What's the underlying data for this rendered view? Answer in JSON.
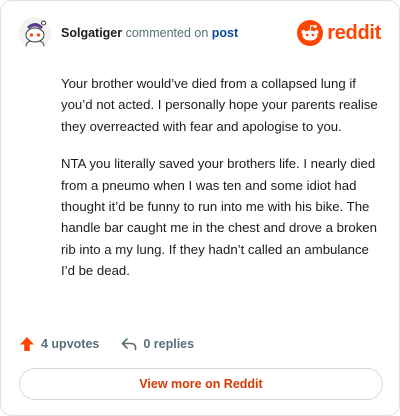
{
  "header": {
    "username": "Solgatiger",
    "action_text": "commented on",
    "post_link": "post",
    "brand": "reddit"
  },
  "comment": {
    "paragraphs": [
      "Your brother would’ve died from a collapsed lung if you’d not acted. I personally hope your parents realise they overreacted with fear and apologise to you.",
      "NTA you literally saved your brothers life. I nearly died from a pneumo when I was ten and some idiot had thought it’d be funny to run into me with his bike. The handle bar caught me in the chest and drove a broken rib into a my lung. If they hadn’t called an ambulance I’d be dead."
    ]
  },
  "actions": {
    "upvotes": "4 upvotes",
    "replies": "0 replies"
  },
  "footer": {
    "view_more": "View more on Reddit"
  },
  "colors": {
    "brand": "#ff4500",
    "link": "#0a4d9e",
    "view_more": "#d93a00"
  }
}
